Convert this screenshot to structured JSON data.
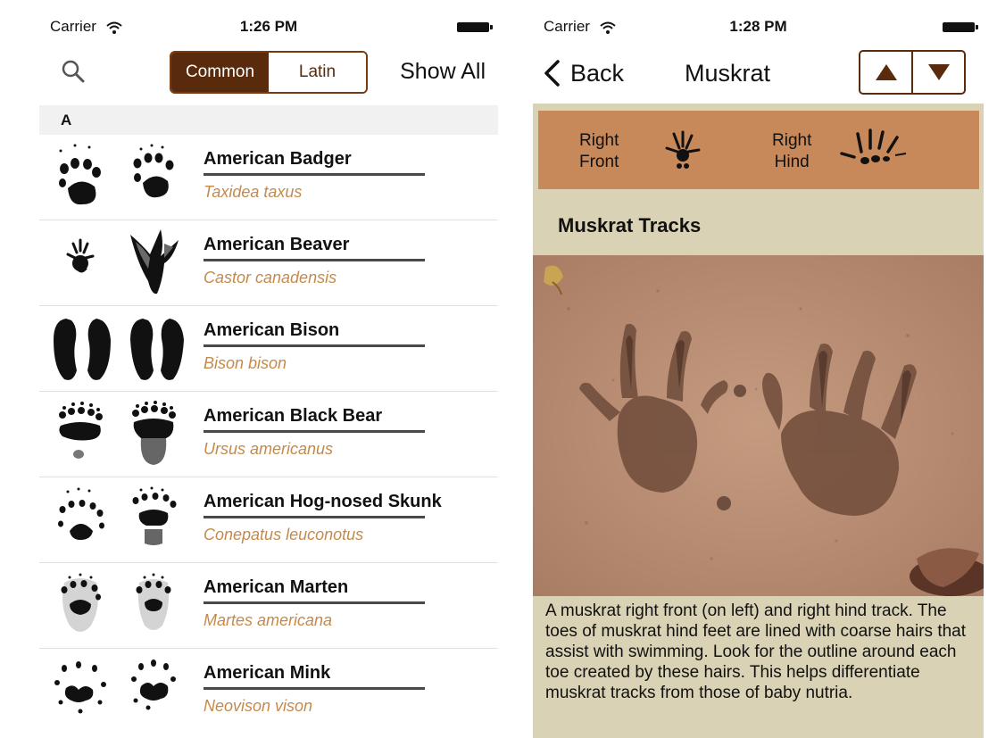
{
  "left_screen": {
    "status": {
      "carrier": "Carrier",
      "time": "1:26 PM"
    },
    "toolbar": {
      "segments": [
        "Common",
        "Latin"
      ],
      "selected_segment": "Common",
      "show_all": "Show All"
    },
    "section_header": "A",
    "species": [
      {
        "common": "American Badger",
        "latin": "Taxidea taxus",
        "front_icon": "badger-front-track-icon",
        "hind_icon": "badger-hind-track-icon"
      },
      {
        "common": "American Beaver",
        "latin": "Castor canadensis",
        "front_icon": "beaver-front-track-icon",
        "hind_icon": "beaver-hind-track-icon"
      },
      {
        "common": "American Bison",
        "latin": "Bison bison",
        "front_icon": "bison-front-track-icon",
        "hind_icon": "bison-hind-track-icon"
      },
      {
        "common": "American Black Bear",
        "latin": "Ursus americanus",
        "front_icon": "black-bear-front-track-icon",
        "hind_icon": "black-bear-hind-track-icon"
      },
      {
        "common": "American Hog-nosed Skunk",
        "latin": "Conepatus leuconotus",
        "front_icon": "skunk-front-track-icon",
        "hind_icon": "skunk-hind-track-icon"
      },
      {
        "common": "American Marten",
        "latin": "Martes americana",
        "front_icon": "marten-front-track-icon",
        "hind_icon": "marten-hind-track-icon"
      },
      {
        "common": "American Mink",
        "latin": "Neovison vison",
        "front_icon": "mink-front-track-icon",
        "hind_icon": "mink-hind-track-icon"
      }
    ]
  },
  "right_screen": {
    "status": {
      "carrier": "Carrier",
      "time": "1:28 PM"
    },
    "nav": {
      "back_label": "Back",
      "title": "Muskrat"
    },
    "track_banner": {
      "front_label": "Right\nFront",
      "hind_label": "Right\nHind"
    },
    "tracks_title": "Muskrat Tracks",
    "caption": "A muskrat right front (on left) and right hind track. The toes of muskrat hind feet are lined with coarse hairs that assist with swimming. Look for the outline around each toe created by these hairs. This helps differentiate muskrat tracks from those of baby nutria."
  },
  "colors": {
    "brand_brown": "#5a2a0d",
    "latin_text": "#c48a4c",
    "banner_tan": "#c8895a",
    "content_bg": "#d9d2b4"
  }
}
